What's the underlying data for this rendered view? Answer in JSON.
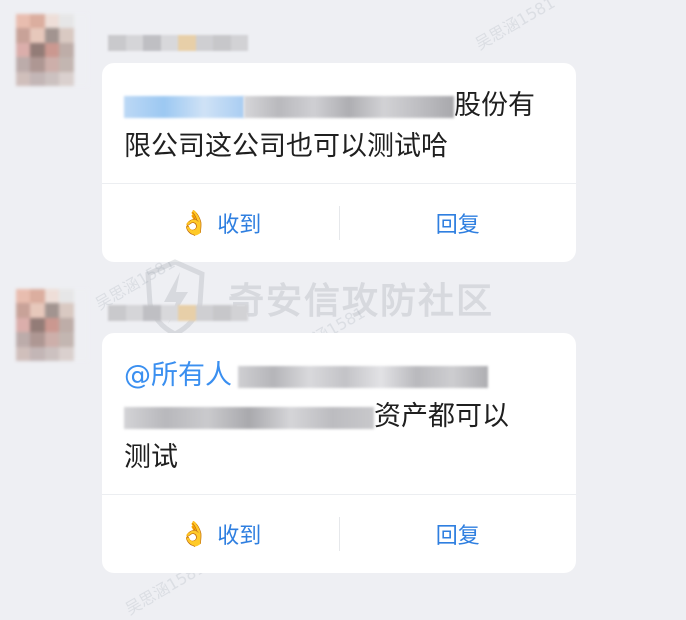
{
  "messages": [
    {
      "text_line1_tail": "股份有",
      "text_line2": "限公司这公司也可以测试哈",
      "ack_label": "收到",
      "reply_label": "回复"
    },
    {
      "mention": "@所有人",
      "text_line2_tail": "资产都可以",
      "text_line3": "测试",
      "ack_label": "收到",
      "reply_label": "回复"
    }
  ],
  "icons": {
    "ack": "ok-hand-icon",
    "ack_glyph": "👌"
  },
  "watermark": {
    "text": "奇安信攻防社区",
    "faint": "吴思涵1581"
  },
  "colors": {
    "background": "#eeeff3",
    "card": "#ffffff",
    "accent": "#2f7fe0",
    "mention": "#3a8ff0",
    "text": "#1f1f1f"
  }
}
